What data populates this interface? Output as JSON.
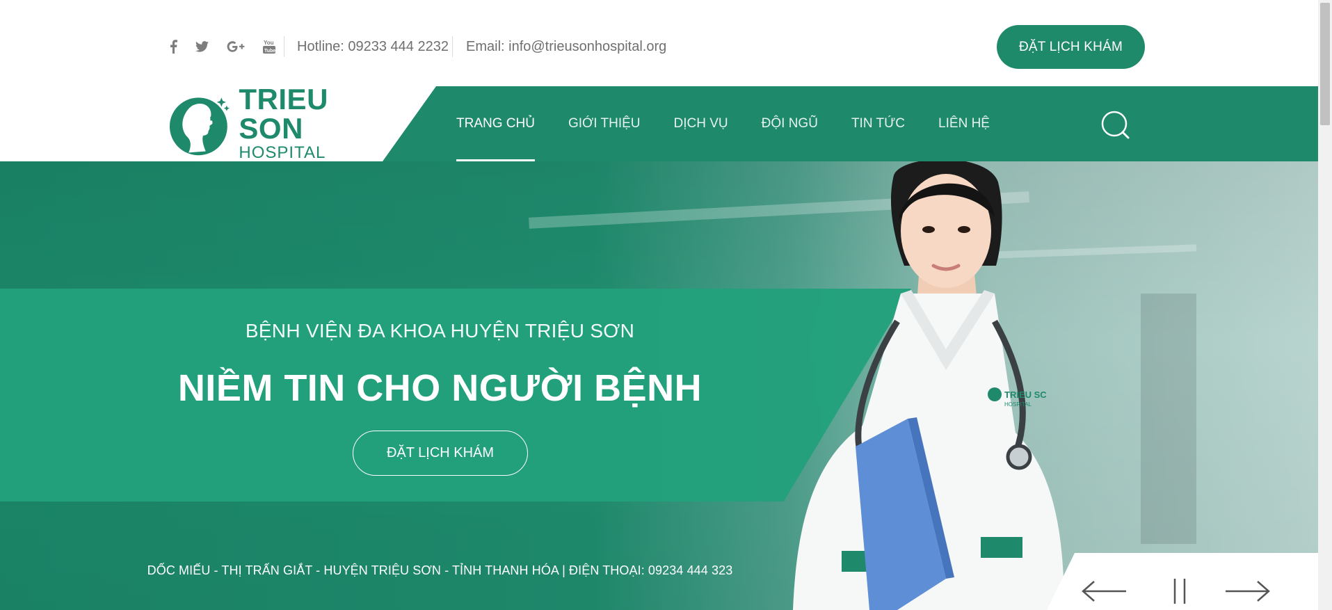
{
  "socials": [
    "facebook-icon",
    "twitter-icon",
    "google-plus-icon",
    "youtube-icon"
  ],
  "topbar": {
    "hotline": "Hotline: 09233 444 2232",
    "email": "Email: info@trieusonhospital.org",
    "book_button": "ĐẶT LỊCH KHÁM"
  },
  "logo": {
    "name": "TRIEU SON",
    "sub": "HOSPITAL"
  },
  "menu": [
    {
      "label": "TRANG CHỦ",
      "active": true
    },
    {
      "label": "GIỚI THIỆU",
      "active": false
    },
    {
      "label": "DỊCH VỤ",
      "active": false
    },
    {
      "label": "ĐỘI NGŨ",
      "active": false
    },
    {
      "label": "TIN TỨC",
      "active": false
    },
    {
      "label": "LIÊN HỆ",
      "active": false
    }
  ],
  "hero": {
    "subtitle": "BỆNH VIỆN ĐA KHOA HUYỆN TRIỆU SƠN",
    "title": "NIỀM TIN CHO NGƯỜI BỆNH",
    "book_button": "ĐẶT LỊCH KHÁM",
    "address": "DỐC MIẾU - THỊ TRẤN GIẮT - HUYỆN TRIỆU SƠN - TỈNH THANH HÓA | ĐIỆN THOẠI: 09234 444 323",
    "coat_badge": "TRIEU SC",
    "coat_badge_sub": "HOSPITAL"
  },
  "slider": {
    "prev_icon": "arrow-left-icon",
    "pause_icon": "pause-icon",
    "next_icon": "arrow-right-icon"
  },
  "colors": {
    "brand": "#1e8a6b",
    "band": "#22a07c",
    "text_gray": "#6f6f6f"
  }
}
